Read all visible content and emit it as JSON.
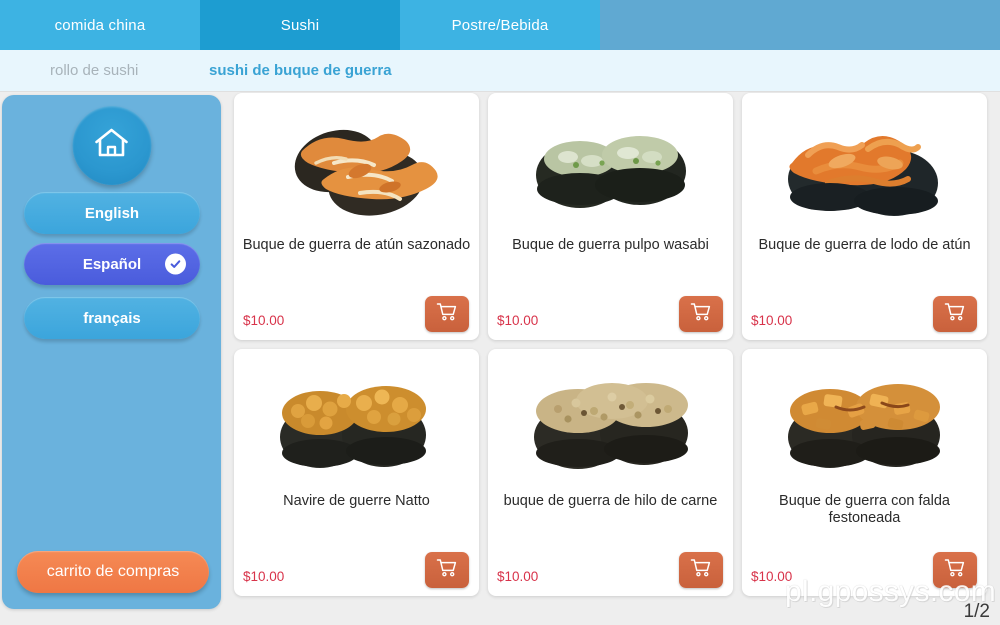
{
  "tabs": [
    {
      "label": "comida china",
      "active": false
    },
    {
      "label": "Sushi",
      "active": true
    },
    {
      "label": "Postre/Bebida",
      "active": false
    }
  ],
  "subnav": [
    {
      "label": "rollo de sushi",
      "active": false
    },
    {
      "label": "sushi de buque de guerra",
      "active": true
    }
  ],
  "sidebar": {
    "home_icon": "home-icon",
    "languages": [
      {
        "label": "English",
        "selected": false
      },
      {
        "label": "Español",
        "selected": true
      },
      {
        "label": "français",
        "selected": false
      }
    ],
    "cart_label": "carrito de compras"
  },
  "products": [
    {
      "title": "Buque de guerra de atún sazonado",
      "price": "$10.00",
      "cart_icon": "shopping-cart-icon",
      "image": "seasoned-tuna-gunkan-sushi"
    },
    {
      "title": "Buque de guerra pulpo wasabi",
      "price": "$10.00",
      "cart_icon": "shopping-cart-icon",
      "image": "wasabi-octopus-gunkan-sushi"
    },
    {
      "title": "Buque de guerra de lodo de atún",
      "price": "$10.00",
      "cart_icon": "shopping-cart-icon",
      "image": "tuna-mud-gunkan-sushi"
    },
    {
      "title": "Navire de guerre Natto",
      "price": "$10.00",
      "cart_icon": "shopping-cart-icon",
      "image": "natto-gunkan-sushi"
    },
    {
      "title": "buque de guerra de hilo de carne",
      "price": "$10.00",
      "cart_icon": "shopping-cart-icon",
      "image": "meat-floss-gunkan-sushi"
    },
    {
      "title": "Buque de guerra con falda festoneada",
      "price": "$10.00",
      "cart_icon": "shopping-cart-icon",
      "image": "scallop-skirt-gunkan-sushi"
    }
  ],
  "footer": {
    "watermark": "pl.gpossys.com",
    "page_indicator": "1/2"
  },
  "colors": {
    "tab_active": "#1d9dd1",
    "tab_inactive": "#3db3e3",
    "tab_fill": "#60a9d2",
    "subnav_bg": "#e8f6fd",
    "subnav_active_text": "#3aa3d4",
    "sidebar_bg": "#6ab2dd",
    "lang_selected": "#4a5cdc",
    "cart_orange": "#ef7744",
    "price_red": "#d8334a",
    "page_bg": "#eeeeee"
  }
}
